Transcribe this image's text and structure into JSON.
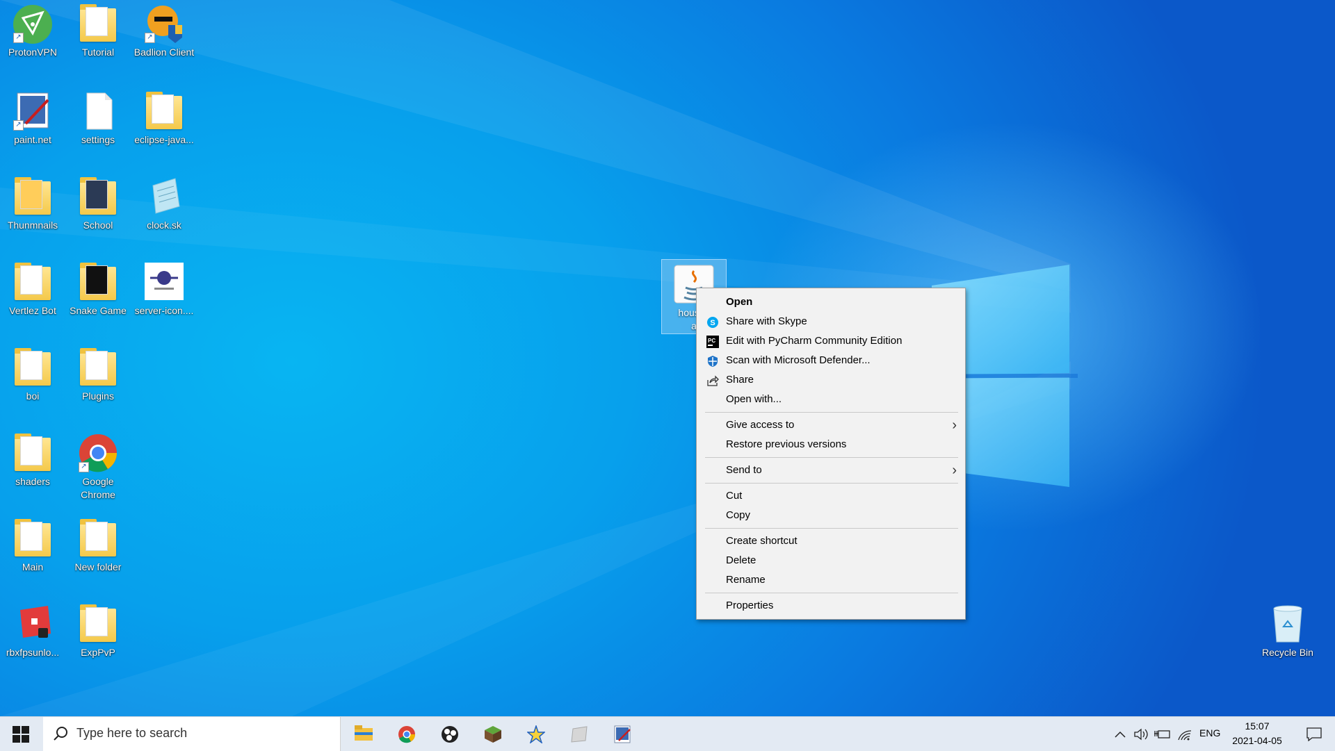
{
  "desktop": {
    "icons": [
      {
        "label": "ProtonVPN",
        "icon": "protonvpn-icon"
      },
      {
        "label": "Tutorial",
        "icon": "folder-icon"
      },
      {
        "label": "Badlion Client",
        "icon": "badlion-icon"
      },
      {
        "label": "paint.net",
        "icon": "paintnet-icon"
      },
      {
        "label": "settings",
        "icon": "file-icon"
      },
      {
        "label": "eclipse-java...",
        "icon": "folder-icon"
      },
      {
        "label": "Thunmnails",
        "icon": "folder-icon"
      },
      {
        "label": "School",
        "icon": "folder-icon"
      },
      {
        "label": "clock.sk",
        "icon": "notepad-icon"
      },
      {
        "label": "Vertlez Bot",
        "icon": "folder-icon"
      },
      {
        "label": "Snake Game",
        "icon": "folder-icon"
      },
      {
        "label": "server-icon....",
        "icon": "image-icon"
      },
      {
        "label": "boi",
        "icon": "folder-icon"
      },
      {
        "label": "Plugins",
        "icon": "folder-icon"
      },
      {
        "label": "shaders",
        "icon": "folder-icon"
      },
      {
        "label": "Google Chrome",
        "icon": "chrome-icon"
      },
      {
        "label": "Main",
        "icon": "folder-icon"
      },
      {
        "label": "New folder",
        "icon": "folder-icon"
      },
      {
        "label": "rbxfpsunlo...",
        "icon": "roblox-icon"
      },
      {
        "label": "ExpPvP",
        "icon": "folder-icon"
      },
      {
        "label": "Recycle Bin",
        "icon": "recycle-bin-icon"
      }
    ],
    "selected_file": {
      "label_line1": "housefl",
      "label_line2": "a",
      "icon": "java-icon"
    }
  },
  "context_menu": {
    "items": [
      {
        "label": "Open",
        "bold": true
      },
      {
        "label": "Share with Skype",
        "icon": "skype-icon"
      },
      {
        "label": "Edit with PyCharm Community Edition",
        "icon": "pycharm-icon"
      },
      {
        "label": "Scan with Microsoft Defender...",
        "icon": "defender-icon"
      },
      {
        "label": "Share",
        "icon": "share-icon"
      },
      {
        "label": "Open with..."
      },
      {
        "label": "Give access to",
        "submenu": true
      },
      {
        "label": "Restore previous versions"
      },
      {
        "label": "Send to",
        "submenu": true
      },
      {
        "label": "Cut"
      },
      {
        "label": "Copy"
      },
      {
        "label": "Create shortcut"
      },
      {
        "label": "Delete"
      },
      {
        "label": "Rename"
      },
      {
        "label": "Properties"
      }
    ]
  },
  "taskbar": {
    "search_placeholder": "Type here to search",
    "apps": [
      "file-explorer-icon",
      "chrome-icon",
      "obs-icon",
      "minecraft-icon",
      "starred-app-icon",
      "roblox-studio-icon",
      "paintnet-icon"
    ],
    "tray": {
      "language": "ENG",
      "time": "15:07",
      "date": "2021-04-05"
    }
  },
  "colors": {
    "desktop_blue": "#07a0ec",
    "taskbar_bg": "#e3eaf3",
    "menu_bg": "#f2f2f2"
  }
}
